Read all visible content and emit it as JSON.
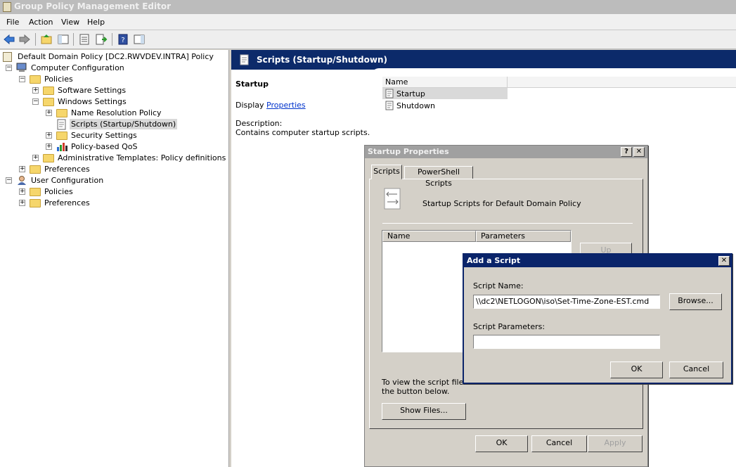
{
  "window": {
    "title": "Group Policy Management Editor"
  },
  "menu": [
    "File",
    "Action",
    "View",
    "Help"
  ],
  "tree": {
    "root": "Default Domain Policy [DC2.RWVDEV.INTRA] Policy",
    "computer_configuration": "Computer Configuration",
    "policies": "Policies",
    "software_settings": "Software Settings",
    "windows_settings": "Windows Settings",
    "name_resolution_policy": "Name Resolution Policy",
    "scripts": "Scripts (Startup/Shutdown)",
    "security_settings": "Security Settings",
    "policy_based_qos": "Policy-based QoS",
    "admin_templates": "Administrative Templates: Policy definitions (ADMX",
    "preferences": "Preferences",
    "user_configuration": "User Configuration",
    "user_policies": "Policies",
    "user_preferences": "Preferences"
  },
  "right_pane": {
    "header": "Scripts (Startup/Shutdown)",
    "heading": "Startup",
    "display_prefix": "Display",
    "properties_link": "Properties",
    "description_label": "Description:",
    "description_text": "Contains computer startup scripts.",
    "list_header": "Name",
    "items": [
      "Startup",
      "Shutdown"
    ]
  },
  "startup_dialog": {
    "title": "Startup Properties",
    "tabs": [
      "Scripts",
      "PowerShell Scripts"
    ],
    "caption": "Startup Scripts for Default Domain Policy",
    "col_name": "Name",
    "col_params": "Parameters",
    "up_button": "Up",
    "hint_line1": "To view the script files st",
    "hint_line2": "the button below.",
    "show_files": "Show Files...",
    "ok": "OK",
    "cancel": "Cancel",
    "apply": "Apply"
  },
  "add_script_dialog": {
    "title": "Add a Script",
    "script_name_label": "Script Name:",
    "script_name_value": "\\\\dc2\\NETLOGON\\iso\\Set-Time-Zone-EST.cmd",
    "browse": "Browse...",
    "params_label": "Script Parameters:",
    "params_value": "",
    "ok": "OK",
    "cancel": "Cancel"
  },
  "colors": {
    "header_blue": "#0c2a6a",
    "dialog_gray": "#d4d0c8"
  }
}
